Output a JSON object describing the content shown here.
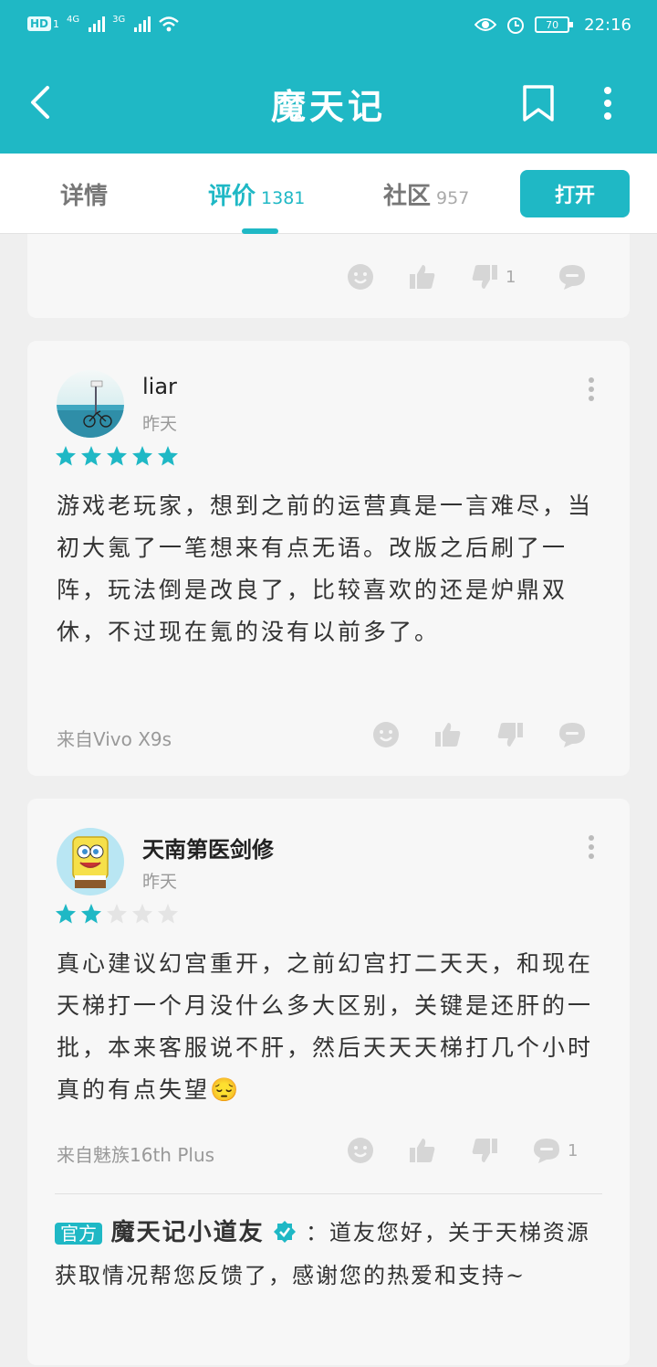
{
  "status_bar": {
    "time": "22:16",
    "battery": "70",
    "hd": "HD",
    "net1": "4G",
    "net2": "3G",
    "sim": "1"
  },
  "header": {
    "title": "魔天记"
  },
  "tabs": [
    {
      "label": "详情",
      "count": ""
    },
    {
      "label": "评价",
      "count": "1381"
    },
    {
      "label": "社区",
      "count": "957"
    }
  ],
  "open_button": "打开",
  "colors": {
    "accent": "#1fb8c5",
    "star_on": "#1fb8c5",
    "star_off": "#e4e4e4"
  },
  "reviews": [
    {
      "dislike_count": "1"
    },
    {
      "username": "liar",
      "time": "昨天",
      "rating": 5,
      "text": "游戏老玩家，想到之前的运营真是一言难尽，当初大氪了一笔想来有点无语。改版之后刷了一阵，玩法倒是改良了，比较喜欢的还是炉鼎双休，不过现在氪的没有以前多了。",
      "device": "来自Vivo X9s"
    },
    {
      "username": "天南第医剑修",
      "time": "昨天",
      "rating": 2,
      "text": "真心建议幻宫重开，之前幻宫打二天天，和现在天梯打一个月没什么多大区别，关键是还肝的一批，本来客服说不肝，然后天天天梯打几个小时真的有点失望😔",
      "device": "来自魅族16th Plus",
      "comment_count": "1",
      "reply": {
        "tag": "官方",
        "name": "魔天记小道友",
        "text": "：道友您好，关于天梯资源获取情况帮您反馈了，感谢您的热爱和支持~"
      }
    }
  ]
}
